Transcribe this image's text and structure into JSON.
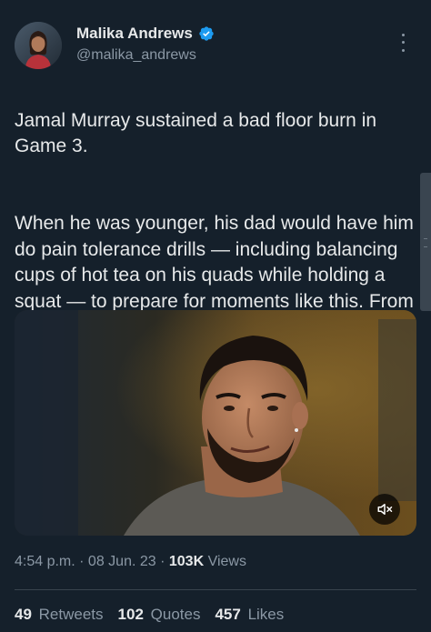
{
  "author": {
    "name": "Malika Andrews",
    "handle": "@malika_andrews",
    "verified": true
  },
  "tweet": {
    "paragraph_1": "Jamal Murray sustained a bad floor burn in Game 3.",
    "paragraph_2": "When he was younger, his dad would have him do pain tolerance drills — including balancing cups of hot tea on his quads while holding a squat — to prepare for moments like this. From NBA Today:"
  },
  "meta": {
    "time": "4:54 p.m.",
    "separator": " · ",
    "date": "08 Jun. 23",
    "views_count": "103K",
    "views_label": "Views"
  },
  "stats": {
    "retweets_count": "49",
    "retweets_label": "Retweets",
    "quotes_count": "102",
    "quotes_label": "Quotes",
    "likes_count": "457",
    "likes_label": "Likes"
  },
  "icons": {
    "verified": "verified-badge-icon",
    "more": "more-options-icon",
    "mute": "speaker-muted-icon"
  },
  "colors": {
    "background": "#15202b",
    "text_primary": "#e7e9ea",
    "text_secondary": "#8b98a5",
    "verified_blue": "#1d9bf0",
    "divider": "#38444d"
  }
}
